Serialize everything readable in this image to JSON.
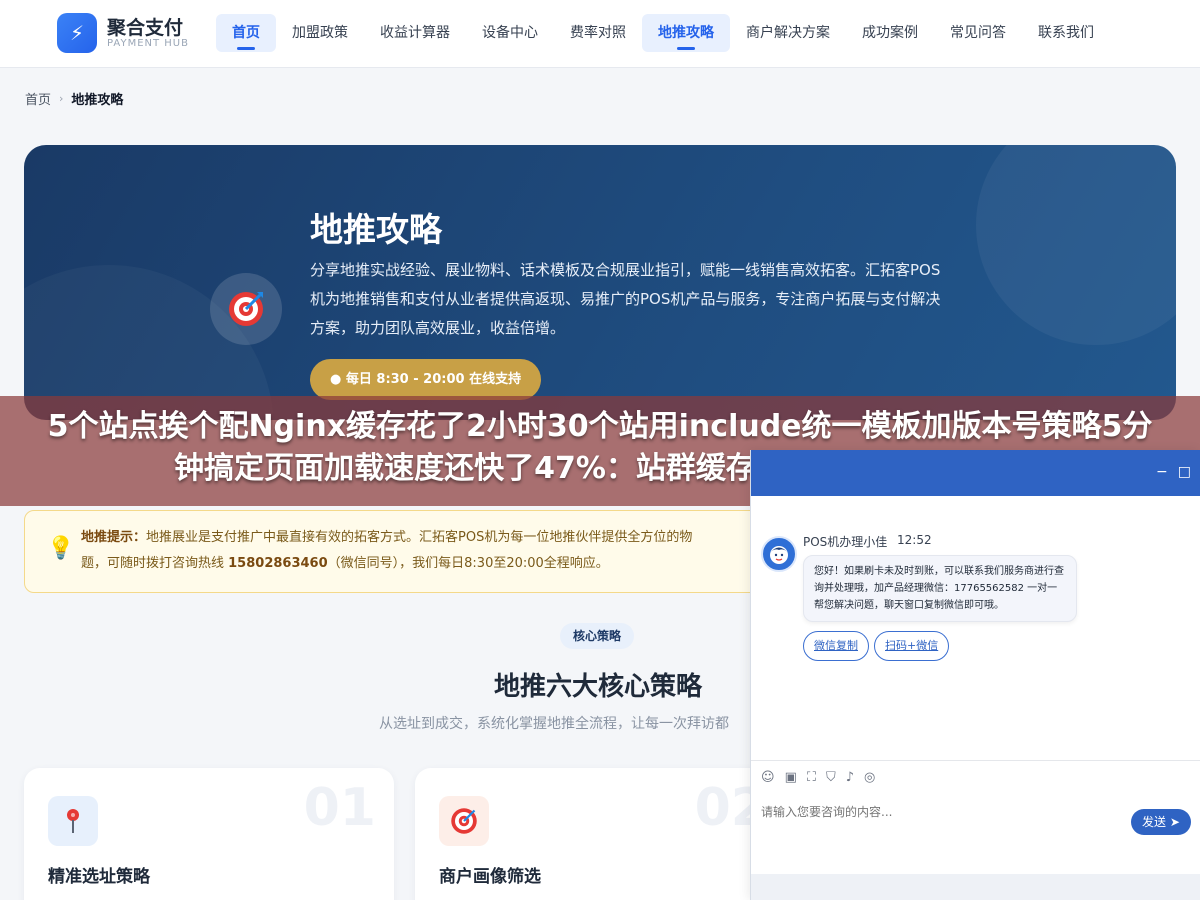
{
  "header": {
    "logo_icon": "lightning-icon",
    "logo_title": "聚合支付",
    "logo_subtitle": "PAYMENT HUB",
    "nav": [
      {
        "label": "首页",
        "active": true
      },
      {
        "label": "加盟政策",
        "active": false
      },
      {
        "label": "收益计算器",
        "active": false
      },
      {
        "label": "设备中心",
        "active": false
      },
      {
        "label": "费率对照",
        "active": false
      },
      {
        "label": "地推攻略",
        "active": true
      },
      {
        "label": "商户解决方案",
        "active": false
      },
      {
        "label": "成功案例",
        "active": false
      },
      {
        "label": "常见问答",
        "active": false
      },
      {
        "label": "联系我们",
        "active": false
      }
    ]
  },
  "breadcrumb": {
    "home": "首页",
    "separator": "›",
    "current": "地推攻略"
  },
  "hero": {
    "icon": "target-icon",
    "title": "地推攻略",
    "description": "分享地推实战经验、展业物料、话术模板及合规展业指引，赋能一线销售高效拓客。汇拓客POS机为地推销售和支付从业者提供高返现、易推广的POS机产品与服务，专注商户拓展与支付解决方案，助力团队高效展业，收益倍增。",
    "button": "● 每日 8:30 - 20:00 在线支持"
  },
  "banner": {
    "text": "5个站点挨个配Nginx缓存花了2小时30个站用include统一模板加版本号策略5分钟搞定页面加载速度还快了47%：站群缓存批量管理不用每个站"
  },
  "tip": {
    "icon": "lightbulb-icon",
    "label": "地推提示：",
    "text": "地推展业是支付推广中最直接有效的拓客方式。汇拓客POS机为每一位地推伙伴提供全方位的物",
    "text2": "题，可随时拨打咨询热线 ",
    "phone": "15802863460",
    "text3": "（微信同号），我们每日8:30至20:00全程响应。"
  },
  "section": {
    "badge": "核心策略",
    "title": "地推六大核心策略",
    "subtitle": "从选址到成交，系统化掌握地推全流程，让每一次拜访都"
  },
  "cards": [
    {
      "num": "01",
      "title": "精准选址策略",
      "icon": "pin-icon"
    },
    {
      "num": "02",
      "title": "商户画像筛选",
      "icon": "target-icon"
    }
  ],
  "chat": {
    "window_buttons": [
      "−",
      "□"
    ],
    "agent_name": "POS机办理小佳",
    "time": "12:52",
    "message": "您好！如果刷卡未及时到账，可以联系我们服务商进行查询并处理哦，加产品经理微信：17765562582 一对一帮您解决问题，聊天窗口复制微信即可哦。",
    "actions": [
      "微信复制",
      "扫码+微信"
    ],
    "toolbar_icons": [
      "smile-icon",
      "image-icon",
      "screenshot-icon",
      "shield-icon",
      "sound-icon",
      "chat-icon"
    ],
    "input_placeholder": "请输入您要咨询的内容...",
    "send": "发送"
  }
}
